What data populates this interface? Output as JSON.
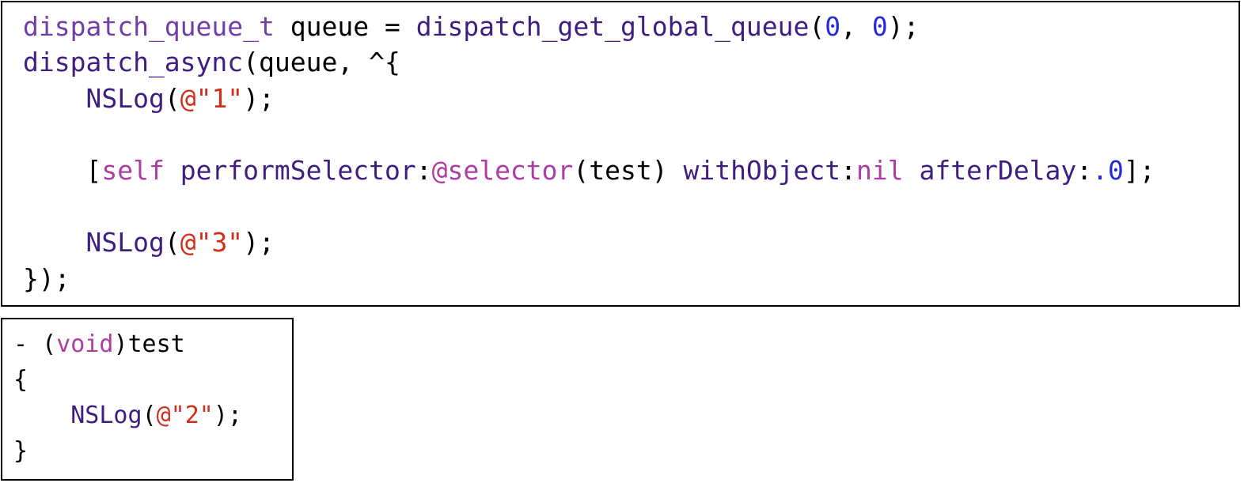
{
  "colors": {
    "plain": "#000000",
    "type": "#703daa",
    "function": "#3e1e81",
    "number": "#272ad8",
    "keyword": "#ad3da4",
    "string": "#d12f1b"
  },
  "main_snippet": {
    "lines": [
      {
        "tokens": [
          {
            "kind": "type",
            "text": "dispatch_queue_t"
          },
          {
            "kind": "plain",
            "text": " queue = "
          },
          {
            "kind": "func",
            "text": "dispatch_get_global_queue"
          },
          {
            "kind": "plain",
            "text": "("
          },
          {
            "kind": "num",
            "text": "0"
          },
          {
            "kind": "plain",
            "text": ", "
          },
          {
            "kind": "num",
            "text": "0"
          },
          {
            "kind": "plain",
            "text": ");"
          }
        ]
      },
      {
        "tokens": [
          {
            "kind": "func",
            "text": "dispatch_async"
          },
          {
            "kind": "plain",
            "text": "(queue, ^{"
          }
        ]
      },
      {
        "tokens": [
          {
            "kind": "plain",
            "text": "    "
          },
          {
            "kind": "func",
            "text": "NSLog"
          },
          {
            "kind": "plain",
            "text": "("
          },
          {
            "kind": "str",
            "text": "@\"1\""
          },
          {
            "kind": "plain",
            "text": ");"
          }
        ]
      },
      {
        "tokens": [
          {
            "kind": "plain",
            "text": "    ["
          },
          {
            "kind": "kw",
            "text": "self"
          },
          {
            "kind": "plain",
            "text": " "
          },
          {
            "kind": "func",
            "text": "performSelector"
          },
          {
            "kind": "plain",
            "text": ":"
          },
          {
            "kind": "kw",
            "text": "@selector"
          },
          {
            "kind": "plain",
            "text": "(test) "
          },
          {
            "kind": "func",
            "text": "withObject"
          },
          {
            "kind": "plain",
            "text": ":"
          },
          {
            "kind": "kw",
            "text": "nil"
          },
          {
            "kind": "plain",
            "text": " "
          },
          {
            "kind": "func",
            "text": "afterDelay"
          },
          {
            "kind": "plain",
            "text": ":"
          },
          {
            "kind": "num",
            "text": ".0"
          },
          {
            "kind": "plain",
            "text": "];"
          }
        ]
      },
      {
        "tokens": [
          {
            "kind": "plain",
            "text": "    "
          },
          {
            "kind": "func",
            "text": "NSLog"
          },
          {
            "kind": "plain",
            "text": "("
          },
          {
            "kind": "str",
            "text": "@\"3\""
          },
          {
            "kind": "plain",
            "text": ");"
          }
        ]
      },
      {
        "tokens": [
          {
            "kind": "plain",
            "text": "});"
          }
        ]
      }
    ]
  },
  "test_snippet": {
    "lines": [
      {
        "tokens": [
          {
            "kind": "plain",
            "text": "- ("
          },
          {
            "kind": "kw",
            "text": "void"
          },
          {
            "kind": "plain",
            "text": ")test"
          }
        ]
      },
      {
        "tokens": [
          {
            "kind": "plain",
            "text": "{"
          }
        ]
      },
      {
        "tokens": [
          {
            "kind": "plain",
            "text": "    "
          },
          {
            "kind": "func",
            "text": "NSLog"
          },
          {
            "kind": "plain",
            "text": "("
          },
          {
            "kind": "str",
            "text": "@\"2\""
          },
          {
            "kind": "plain",
            "text": ");"
          }
        ]
      },
      {
        "tokens": [
          {
            "kind": "plain",
            "text": "}"
          }
        ]
      }
    ]
  }
}
